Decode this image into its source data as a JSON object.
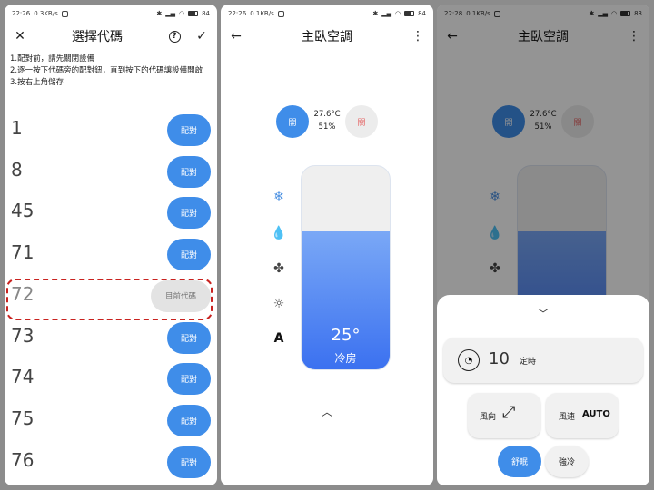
{
  "status": {
    "p1": {
      "time": "22:26",
      "speed": "0.3KB/s",
      "battery": "84"
    },
    "p2": {
      "time": "22:26",
      "speed": "0.1KB/s",
      "battery": "84"
    },
    "p3": {
      "time": "22:28",
      "speed": "0.1KB/s",
      "battery": "83"
    }
  },
  "code_screen": {
    "title": "選擇代碼",
    "instructions": [
      "1.配對前，請先關閉設備",
      "2.逐一按下代碼旁的配對鈕，直到按下的代碼讓設備開啟",
      "3.按右上角儲存"
    ],
    "rows": [
      {
        "code": "1",
        "button": "配對"
      },
      {
        "code": "8",
        "button": "配對"
      },
      {
        "code": "45",
        "button": "配對"
      },
      {
        "code": "71",
        "button": "配對"
      },
      {
        "code": "72",
        "button": "目前代碼"
      },
      {
        "code": "73",
        "button": "配對"
      },
      {
        "code": "74",
        "button": "配對"
      },
      {
        "code": "75",
        "button": "配對"
      },
      {
        "code": "76",
        "button": "配對"
      }
    ],
    "current_index": 4
  },
  "ac_screen": {
    "title": "主臥空調",
    "on_label": "開",
    "off_label": "關",
    "room_temp": "27.6°C",
    "humidity": "51%",
    "set_temp": "25°",
    "mode": "冷房",
    "level_fraction": 0.68
  },
  "sheet": {
    "timer_value": "10",
    "timer_label": "定時",
    "swing_label": "風向",
    "fan_label": "風速",
    "fan_value": "AUTO",
    "sleep_label": "舒眠",
    "turbo_label": "強冷"
  },
  "colors": {
    "accent": "#3f8de9",
    "highlight": "#c9221f",
    "off_text": "#e56a6a"
  }
}
